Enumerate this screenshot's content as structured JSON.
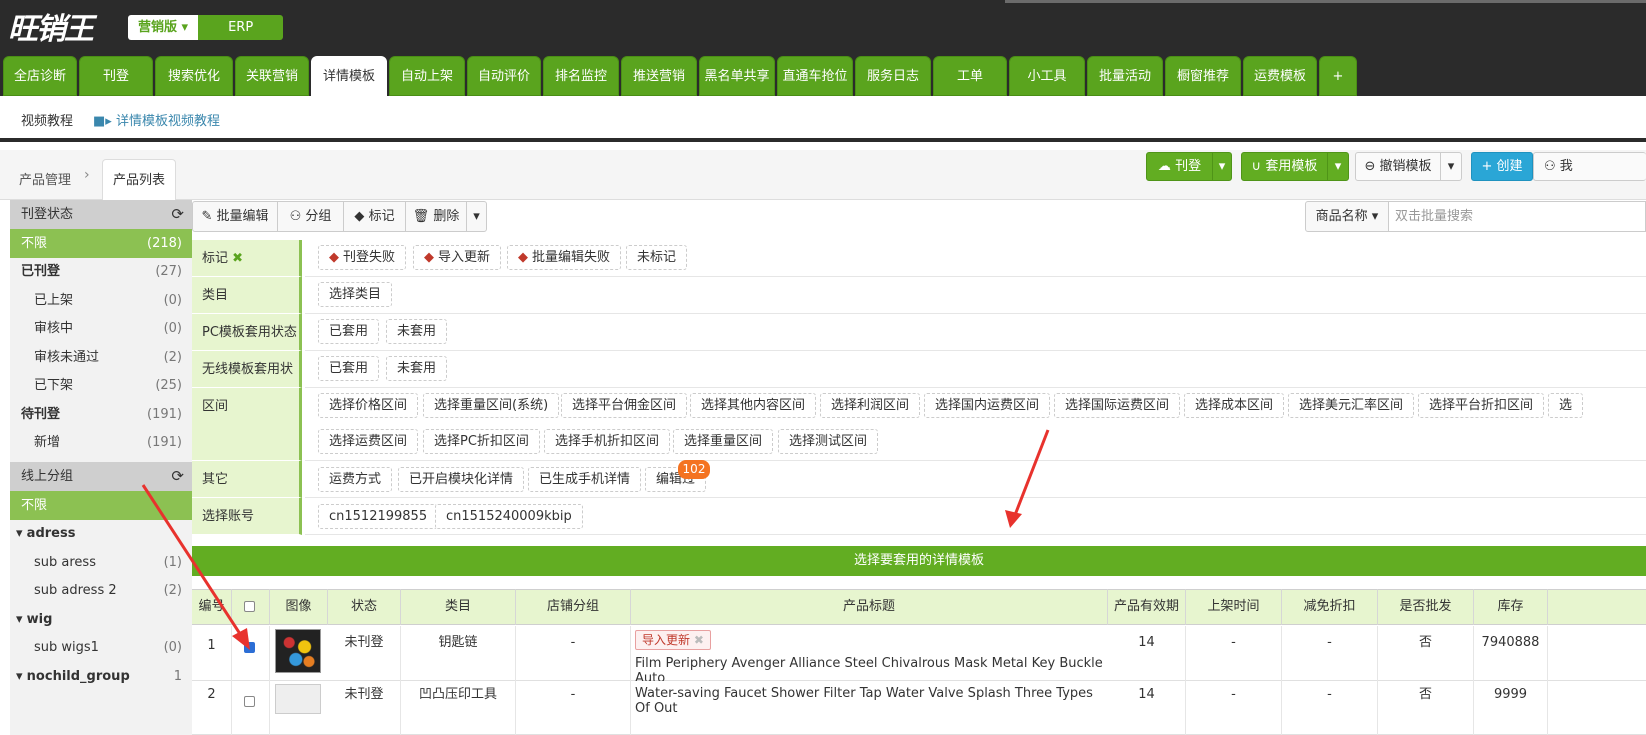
{
  "header": {
    "logo": "旺销王",
    "edition": "营销版",
    "erp": "ERP"
  },
  "nav": {
    "tabs": [
      "全店诊断",
      "刊登",
      "搜索优化",
      "关联营销",
      "详情模板",
      "自动上架",
      "自动评价",
      "排名监控",
      "推送营销",
      "黑名单共享",
      "直通车抢位",
      "服务日志",
      "工单",
      "小工具",
      "批量活动",
      "橱窗推荐",
      "运费模板",
      "+"
    ],
    "active": "详情模板"
  },
  "subnav": {
    "video": "视频教程",
    "video_link": "详情模板视频教程"
  },
  "breadcrumb": {
    "parent": "产品管理",
    "current": "产品列表"
  },
  "actions": {
    "publish": "刊登",
    "apply_template": "套用模板",
    "revoke_template": "撤销模板",
    "create": "创建",
    "more": "我"
  },
  "sidebar": {
    "status_title": "刊登状态",
    "status_items": [
      {
        "label": "不限",
        "count": "(218)"
      },
      {
        "label": "已刊登",
        "count": "(27)"
      },
      {
        "label": "已上架",
        "count": "(0)"
      },
      {
        "label": "审核中",
        "count": "(0)"
      },
      {
        "label": "审核未通过",
        "count": "(2)"
      },
      {
        "label": "已下架",
        "count": "(25)"
      },
      {
        "label": "待刊登",
        "count": "(191)"
      },
      {
        "label": "新增",
        "count": "(191)"
      }
    ],
    "group_title": "线上分组",
    "group_items": [
      {
        "label": "不限",
        "count": ""
      },
      {
        "label": "adress",
        "count": ""
      },
      {
        "label": "sub aress",
        "count": "(1)"
      },
      {
        "label": "sub adress 2",
        "count": "(2)"
      },
      {
        "label": "wig",
        "count": ""
      },
      {
        "label": "sub wigs1",
        "count": "(0)"
      },
      {
        "label": "nochild_group",
        "count": "1"
      }
    ]
  },
  "toolbar": {
    "batch_edit": "批量编辑",
    "group": "分组",
    "mark": "标记",
    "delete": "删除",
    "search_field": "商品名称",
    "search_placeholder": "双击批量搜索"
  },
  "filters": {
    "mark_label": "标记",
    "mark_tags": [
      "刊登失败",
      "导入更新",
      "批量编辑失败",
      "未标记"
    ],
    "category_label": "类目",
    "category_btn": "选择类目",
    "pc_label": "PC模板套用状态",
    "pc_opts": [
      "已套用",
      "未套用"
    ],
    "mobile_label": "无线模板套用状态",
    "mobile_opts": [
      "已套用",
      "未套用"
    ],
    "range_label": "区间",
    "range_row1": [
      "选择价格区间",
      "选择重量区间(系统)",
      "选择平台佣金区间",
      "选择其他内容区间",
      "选择利润区间",
      "选择国内运费区间",
      "选择国际运费区间",
      "选择成本区间",
      "选择美元汇率区间",
      "选择平台折扣区间",
      "选"
    ],
    "range_row2": [
      "选择运费区间",
      "选择PC折扣区间",
      "选择手机折扣区间",
      "选择重量区间",
      "选择测试区间"
    ],
    "other_label": "其它",
    "other_opts": [
      "运费方式",
      "已开启模块化详情",
      "已生成手机详情",
      "编辑过"
    ],
    "other_badge": "102",
    "account_label": "选择账号",
    "accounts": [
      "cn1512199855",
      "cn1515240009kbip"
    ]
  },
  "apply_bar": "选择要套用的详情模板",
  "table": {
    "headers": [
      "编号",
      "",
      "图像",
      "状态",
      "类目",
      "店铺分组",
      "产品标题",
      "产品有效期",
      "上架时间",
      "减免折扣",
      "是否批发",
      "库存"
    ],
    "rows": [
      {
        "no": "1",
        "status": "未刊登",
        "category": "钥匙链",
        "group": "-",
        "tag": "导入更新",
        "title": "Film Periphery Avenger Alliance Steel Chivalrous Mask Metal Key Buckle Auto",
        "validity": "14",
        "listed": "-",
        "discount": "-",
        "wholesale": "否",
        "stock": "7940888"
      },
      {
        "no": "2",
        "status": "未刊登",
        "category": "凹凸压印工具",
        "group": "-",
        "tag": "",
        "title": "Water-saving Faucet Shower Filter Tap Water Valve Splash Three Types Of Out",
        "validity": "14",
        "listed": "-",
        "discount": "-",
        "wholesale": "否",
        "stock": "9999"
      }
    ]
  },
  "colors": {
    "nav_green": "#5aa41e",
    "accent_green": "#62ad22",
    "filter_label_bg": "#e7f5cf",
    "arrow_red": "#e8322d"
  }
}
